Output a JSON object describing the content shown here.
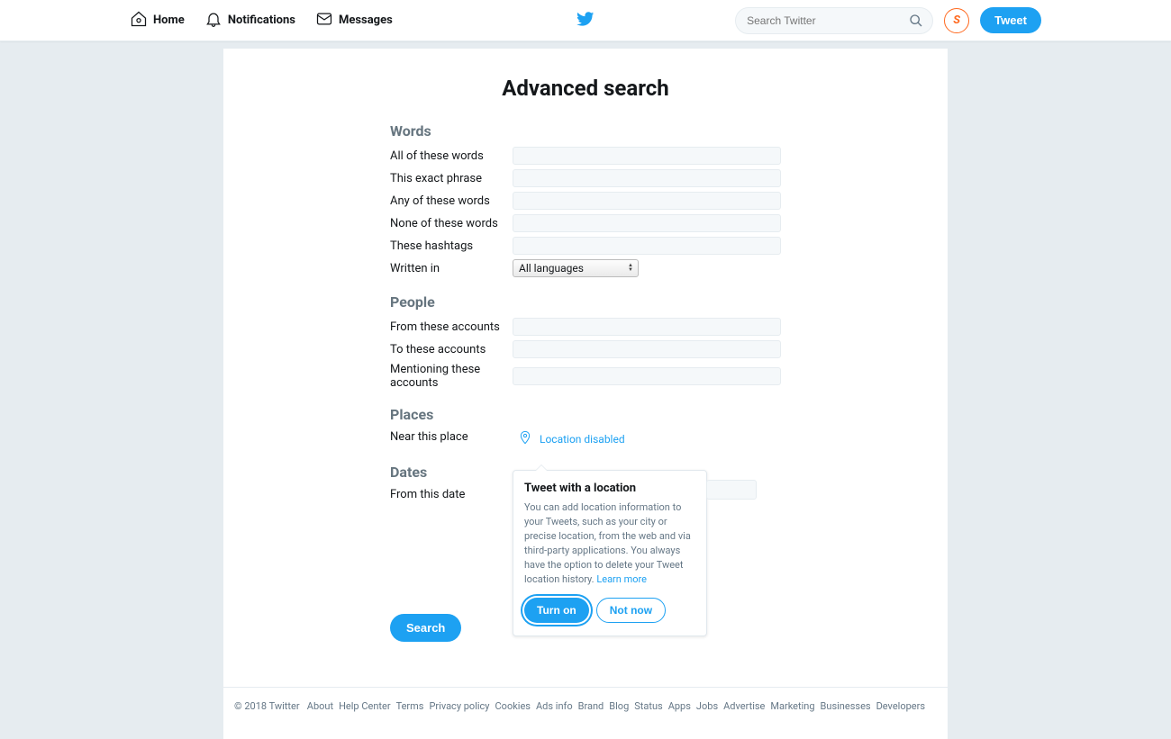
{
  "nav": {
    "home": "Home",
    "notifications": "Notifications",
    "messages": "Messages",
    "search_placeholder": "Search Twitter",
    "avatar_initial": "S",
    "tweet_btn": "Tweet"
  },
  "page": {
    "title": "Advanced search"
  },
  "sections": {
    "words": {
      "heading": "Words",
      "all": "All of these words",
      "exact": "This exact phrase",
      "any": "Any of these words",
      "none": "None of these words",
      "hashtags": "These hashtags",
      "written_in": "Written in",
      "language_selected": "All languages"
    },
    "people": {
      "heading": "People",
      "from": "From these accounts",
      "to": "To these accounts",
      "mentioning": "Mentioning these accounts"
    },
    "places": {
      "heading": "Places",
      "near": "Near this place",
      "location_disabled": "Location disabled"
    },
    "dates": {
      "heading": "Dates",
      "from_date": "From this date"
    }
  },
  "popover": {
    "title": "Tweet with a location",
    "body": "You can add location information to your Tweets, such as your city or precise location, from the web and via third-party applications. You always have the option to delete your Tweet location history. ",
    "learn_more": "Learn more",
    "turn_on": "Turn on",
    "not_now": "Not now"
  },
  "search_button": "Search",
  "footer": {
    "copyright": "© 2018 Twitter",
    "links": [
      "About",
      "Help Center",
      "Terms",
      "Privacy policy",
      "Cookies",
      "Ads info",
      "Brand",
      "Blog",
      "Status",
      "Apps",
      "Jobs",
      "Advertise",
      "Marketing",
      "Businesses",
      "Developers"
    ]
  }
}
